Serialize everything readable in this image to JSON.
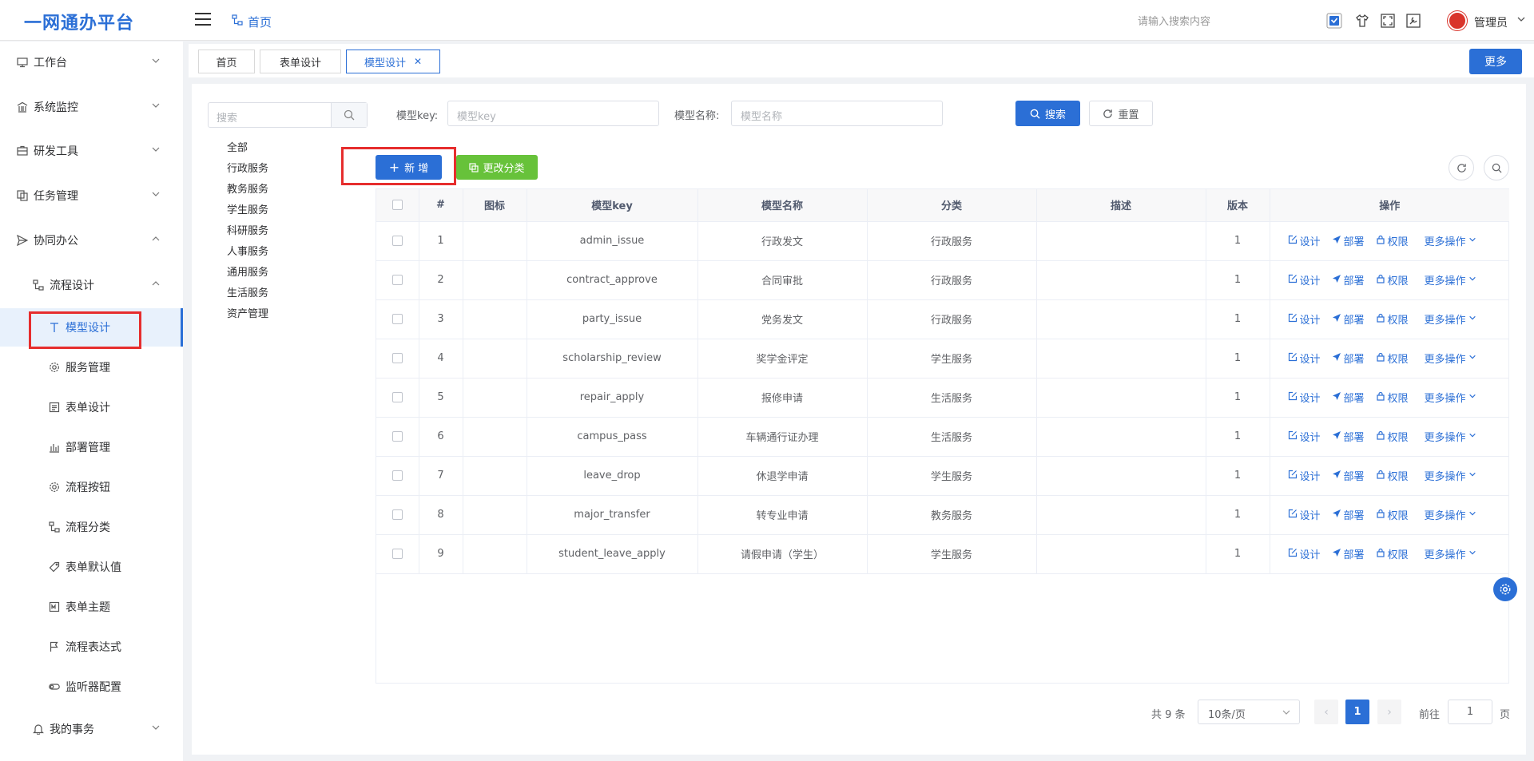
{
  "header": {
    "app_title": "一网通办平台",
    "breadcrumb": "首页",
    "search_placeholder": "请输入搜索内容",
    "user_name": "管理员"
  },
  "sidebar": {
    "items": [
      {
        "label": "工作台",
        "icon": "monitor-icon"
      },
      {
        "label": "系统监控",
        "icon": "bank-icon"
      },
      {
        "label": "研发工具",
        "icon": "toolbox-icon"
      },
      {
        "label": "任务管理",
        "icon": "copy-icon"
      },
      {
        "label": "协同办公",
        "icon": "send-icon"
      },
      {
        "label": "流程设计",
        "icon": "flow-icon"
      },
      {
        "label": "模型设计",
        "icon": "text-icon"
      },
      {
        "label": "服务管理",
        "icon": "gear-icon"
      },
      {
        "label": "表单设计",
        "icon": "form-icon"
      },
      {
        "label": "部署管理",
        "icon": "bar-chart-icon"
      },
      {
        "label": "流程按钮",
        "icon": "gear-icon"
      },
      {
        "label": "流程分类",
        "icon": "flow-icon"
      },
      {
        "label": "表单默认值",
        "icon": "tag-icon"
      },
      {
        "label": "表单主题",
        "icon": "theme-icon"
      },
      {
        "label": "流程表达式",
        "icon": "flag-icon"
      },
      {
        "label": "监听器配置",
        "icon": "toggle-icon"
      },
      {
        "label": "我的事务",
        "icon": "bell-icon"
      }
    ]
  },
  "tabs": [
    {
      "label": "首页"
    },
    {
      "label": "表单设计"
    },
    {
      "label": "模型设计"
    }
  ],
  "more_label": "更多",
  "tree": {
    "search_placeholder": "搜索",
    "items": [
      "全部",
      "行政服务",
      "教务服务",
      "学生服务",
      "科研服务",
      "人事服务",
      "通用服务",
      "生活服务",
      "资产管理"
    ]
  },
  "filters": {
    "key_label": "模型key:",
    "key_placeholder": "模型key",
    "name_label": "模型名称:",
    "name_placeholder": "模型名称",
    "search_label": "搜索",
    "reset_label": "重置"
  },
  "toolbar": {
    "add_label": "新 增",
    "change_category_label": "更改分类"
  },
  "table": {
    "headers": [
      "#",
      "图标",
      "模型key",
      "模型名称",
      "分类",
      "描述",
      "版本",
      "操作"
    ],
    "rows": [
      {
        "no": "1",
        "key": "admin_issue",
        "name": "行政发文",
        "category": "行政服务",
        "version": "1"
      },
      {
        "no": "2",
        "key": "contract_approve",
        "name": "合同审批",
        "category": "行政服务",
        "version": "1"
      },
      {
        "no": "3",
        "key": "party_issue",
        "name": "党务发文",
        "category": "行政服务",
        "version": "1"
      },
      {
        "no": "4",
        "key": "scholarship_review",
        "name": "奖学金评定",
        "category": "学生服务",
        "version": "1"
      },
      {
        "no": "5",
        "key": "repair_apply",
        "name": "报修申请",
        "category": "生活服务",
        "version": "1"
      },
      {
        "no": "6",
        "key": "campus_pass",
        "name": "车辆通行证办理",
        "category": "生活服务",
        "version": "1"
      },
      {
        "no": "7",
        "key": "leave_drop",
        "name": "休退学申请",
        "category": "学生服务",
        "version": "1"
      },
      {
        "no": "8",
        "key": "major_transfer",
        "name": "转专业申请",
        "category": "教务服务",
        "version": "1"
      },
      {
        "no": "9",
        "key": "student_leave_apply",
        "name": "请假申请（学生）",
        "category": "学生服务",
        "version": "1"
      }
    ],
    "ops": {
      "design": "设计",
      "deploy": "部署",
      "perm": "权限",
      "more": "更多操作"
    }
  },
  "pagination": {
    "total": "共 9 条",
    "page_size": "10条/页",
    "current": "1",
    "goto": "前往",
    "goto_value": "1",
    "page_unit": "页"
  },
  "colors": {
    "primary": "#2b6fd6",
    "success": "#67c23a",
    "highlight": "#e62d2d"
  }
}
